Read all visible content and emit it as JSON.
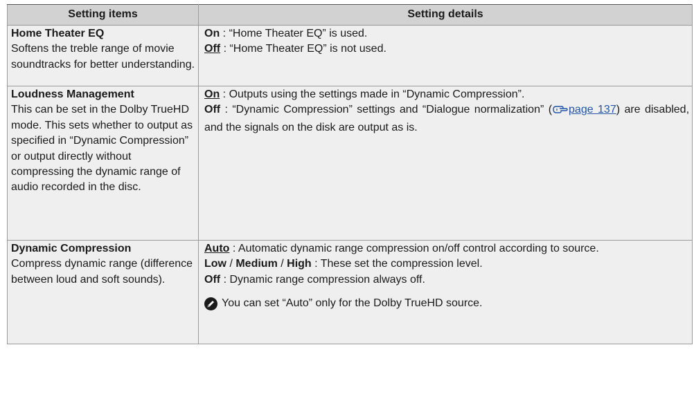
{
  "header": {
    "col1": "Setting items",
    "col2": "Setting details"
  },
  "rows": [
    {
      "title": "Home Theater EQ",
      "desc": "Softens the treble range of movie soundtracks for better understanding.",
      "options": [
        {
          "label": "On",
          "text": ": “Home Theater EQ” is used."
        },
        {
          "label": "Off",
          "text": ": “Home Theater EQ” is not used."
        }
      ]
    },
    {
      "title": "Loudness Management",
      "desc": "This can be set in the Dolby TrueHD mode. This sets whether to output as specified in “Dynamic Compression” or output directly without compressing the dynamic range of audio recorded in the disc.",
      "options": [
        {
          "label": "On",
          "text": ": Outputs using the settings made in “Dynamic Compression”."
        },
        {
          "label": "Off",
          "text": ": “Dynamic Compression” settings and “Dialogue normalization” (",
          "link": "page 137",
          "after": ") are disabled, and the signals on the disk are output as is."
        }
      ]
    },
    {
      "title": "Dynamic Compression",
      "desc": "Compress dynamic range (difference between loud and soft sounds).",
      "options": [
        {
          "label": "Auto",
          "text": ": Automatic dynamic range compression on/off control according to source."
        },
        {
          "label_low": "Low",
          "sep1": " / ",
          "label_med": "Medium",
          "sep2": " / ",
          "label_high": "High",
          "text": ": These set the compression level."
        },
        {
          "label": "Off",
          "text": ": Dynamic range compression always off."
        }
      ],
      "note": "You can set “Auto” only for the Dolby TrueHD source."
    }
  ],
  "icons": {
    "note": "pencil-icon",
    "reference": "pointing-hand-icon"
  },
  "colors": {
    "header_bg": "#d2d2d2",
    "row_bg": "#efefef",
    "link": "#2255aa"
  }
}
